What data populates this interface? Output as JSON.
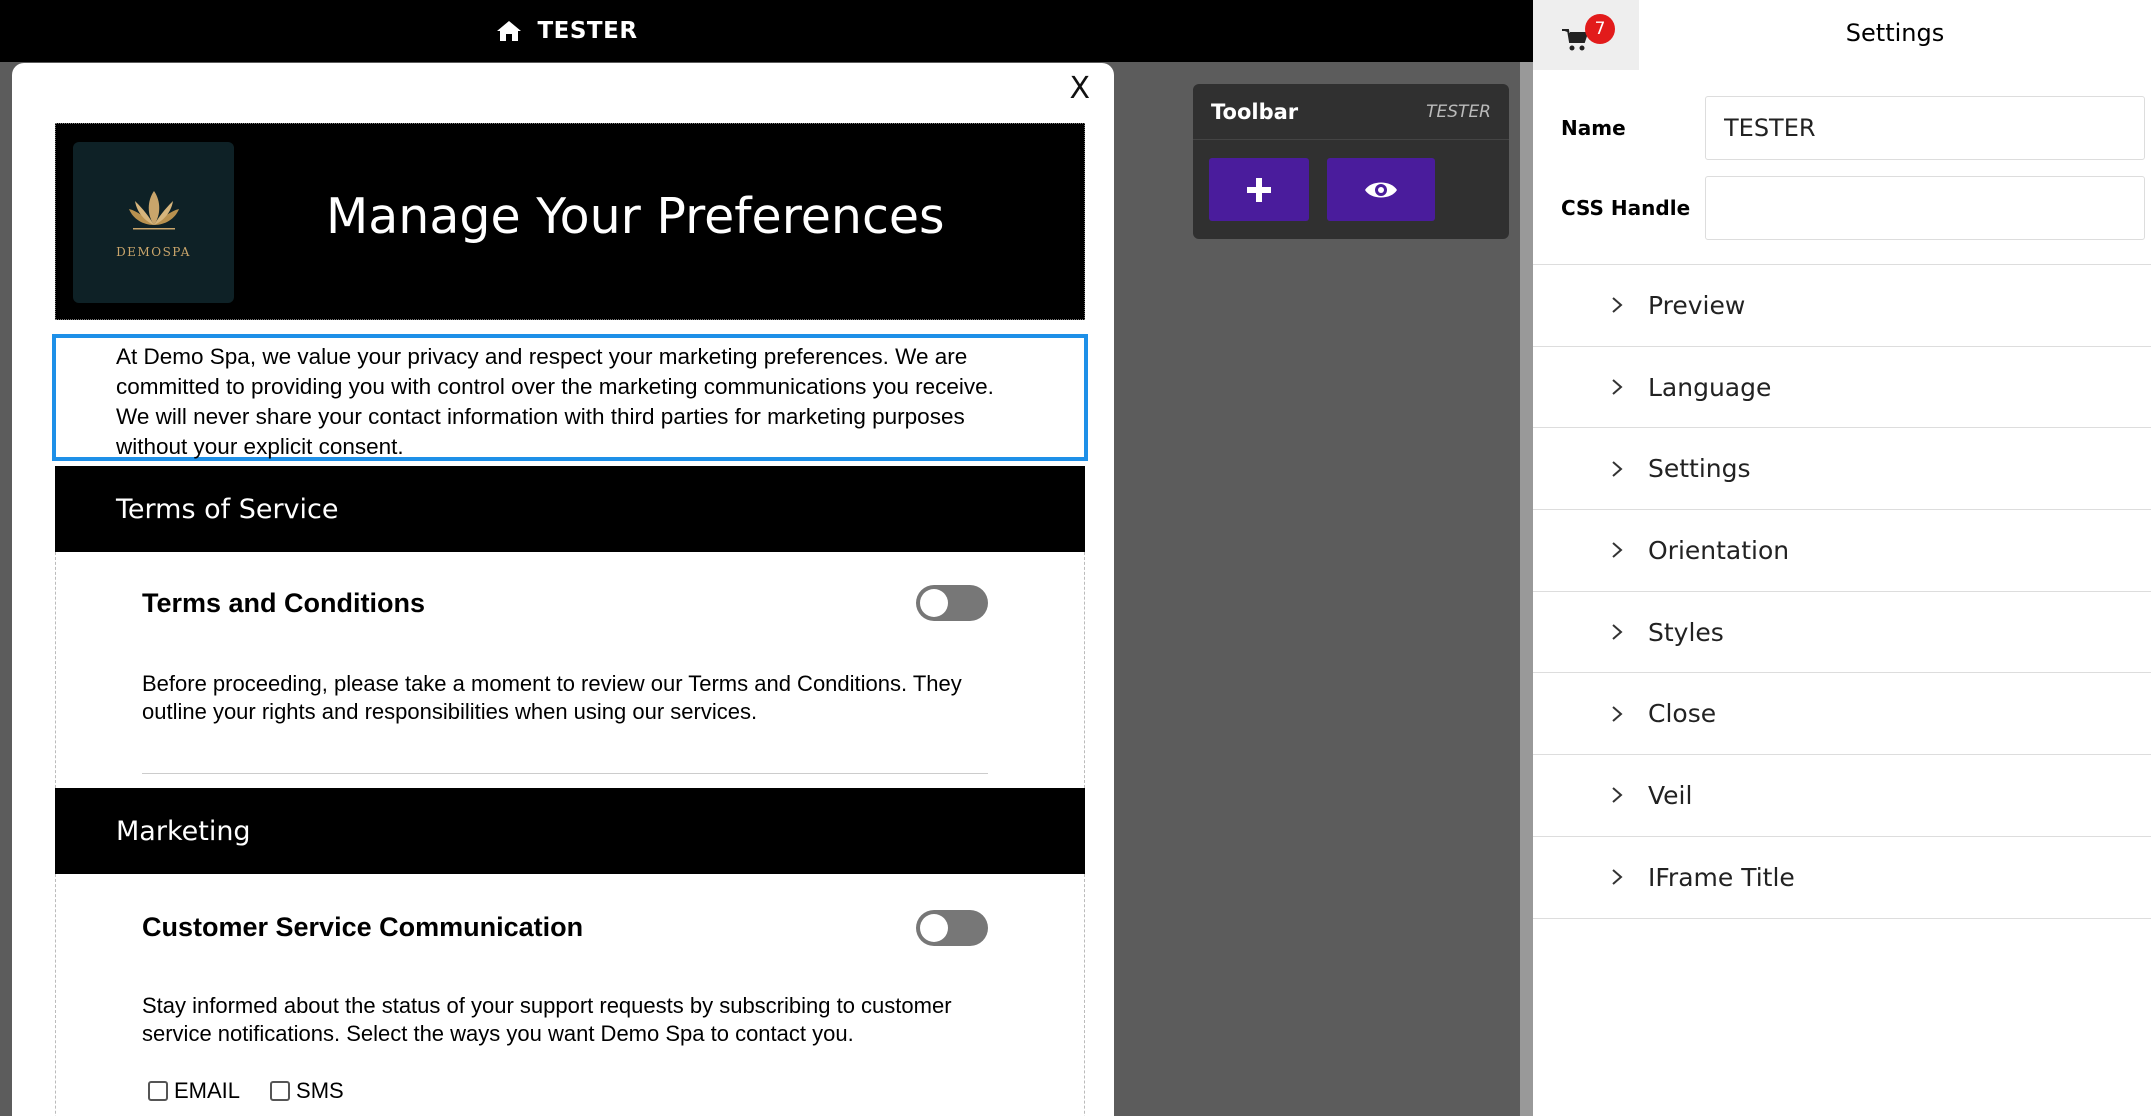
{
  "topbar": {
    "title": "TESTER",
    "icon": "home-icon"
  },
  "modal": {
    "close_label": "X",
    "header": {
      "logo_text": "DEMOSPA",
      "title": "Manage Your Preferences"
    },
    "intro": "At Demo Spa, we value your privacy and respect your marketing preferences. We are committed to providing you with control over the marketing communications you receive. We will never share your contact information with third parties for marketing purposes without your explicit consent.",
    "sections": [
      {
        "heading": "Terms of Service",
        "item_title": "Terms and Conditions",
        "item_desc": "Before proceeding, please take a moment to review our Terms and Conditions. They outline your rights and responsibilities when using our services.",
        "toggle_on": false
      },
      {
        "heading": "Marketing",
        "item_title": "Customer Service Communication",
        "item_desc": "Stay informed about the status of your support requests by subscribing to customer service notifications. Select the ways you want Demo Spa to contact you.",
        "toggle_on": false,
        "options": [
          "EMAIL",
          "SMS"
        ]
      }
    ]
  },
  "toolbar": {
    "title": "Toolbar",
    "name": "TESTER",
    "add_icon": "plus-icon",
    "preview_icon": "eye-icon"
  },
  "panel": {
    "cart_badge": "7",
    "title": "Settings",
    "fields": [
      {
        "label": "Name",
        "value": "TESTER"
      },
      {
        "label": "CSS Handle",
        "value": ""
      }
    ],
    "accordion": [
      "Preview",
      "Language",
      "Settings",
      "Orientation",
      "Styles",
      "Close",
      "Veil",
      "IFrame Title"
    ]
  }
}
